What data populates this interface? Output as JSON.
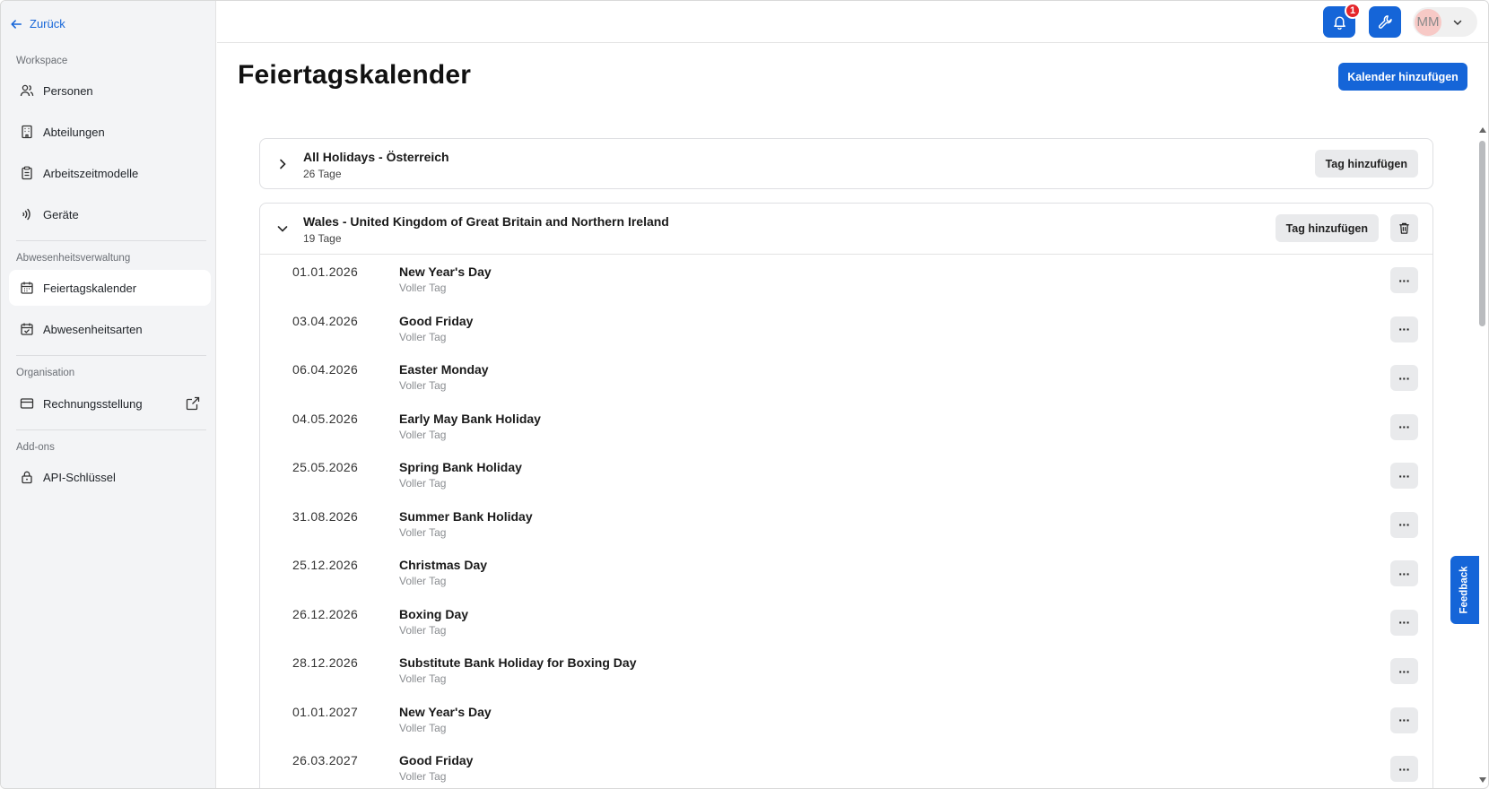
{
  "sidebar": {
    "back_label": "Zurück",
    "sections": {
      "workspace": "Workspace",
      "absence": "Abwesenheitsverwaltung",
      "organisation": "Organisation",
      "addons": "Add-ons"
    },
    "items": [
      {
        "label": "Personen",
        "icon": "users-icon"
      },
      {
        "label": "Abteilungen",
        "icon": "building-icon"
      },
      {
        "label": "Arbeitszeitmodelle",
        "icon": "clipboard-icon"
      },
      {
        "label": "Geräte",
        "icon": "nfc-icon"
      },
      {
        "label": "Feiertagskalender",
        "icon": "calendar-icon",
        "active": true
      },
      {
        "label": "Abwesenheitsarten",
        "icon": "calendar-check-icon"
      },
      {
        "label": "Rechnungsstellung",
        "icon": "credit-card-icon"
      },
      {
        "label": "API-Schlüssel",
        "icon": "lock-icon"
      }
    ]
  },
  "topbar": {
    "notification_count": "1",
    "user_initials": "MM"
  },
  "page": {
    "title": "Feiertagskalender",
    "add_calendar_label": "Kalender hinzufügen"
  },
  "calendars": [
    {
      "name": "All Holidays - Österreich",
      "count": "26 Tage",
      "add_day_label": "Tag hinzufügen",
      "expanded": false
    },
    {
      "name": "Wales - United Kingdom of Great Britain and Northern Ireland",
      "count": "19 Tage",
      "add_day_label": "Tag hinzufügen",
      "expanded": true,
      "days": [
        {
          "date": "01.01.2026",
          "name": "New Year's Day",
          "type": "Voller Tag"
        },
        {
          "date": "03.04.2026",
          "name": "Good Friday",
          "type": "Voller Tag"
        },
        {
          "date": "06.04.2026",
          "name": "Easter Monday",
          "type": "Voller Tag"
        },
        {
          "date": "04.05.2026",
          "name": "Early May Bank Holiday",
          "type": "Voller Tag"
        },
        {
          "date": "25.05.2026",
          "name": "Spring Bank Holiday",
          "type": "Voller Tag"
        },
        {
          "date": "31.08.2026",
          "name": "Summer Bank Holiday",
          "type": "Voller Tag"
        },
        {
          "date": "25.12.2026",
          "name": "Christmas Day",
          "type": "Voller Tag"
        },
        {
          "date": "26.12.2026",
          "name": "Boxing Day",
          "type": "Voller Tag"
        },
        {
          "date": "28.12.2026",
          "name": "Substitute Bank Holiday for Boxing Day",
          "type": "Voller Tag"
        },
        {
          "date": "01.01.2027",
          "name": "New Year's Day",
          "type": "Voller Tag"
        },
        {
          "date": "26.03.2027",
          "name": "Good Friday",
          "type": "Voller Tag"
        }
      ]
    }
  ],
  "more_label": "···",
  "feedback_label": "Feedback",
  "colors": {
    "accent": "#1565d8",
    "badge": "#e5262b",
    "sidebar_bg": "#f3f4f6"
  }
}
